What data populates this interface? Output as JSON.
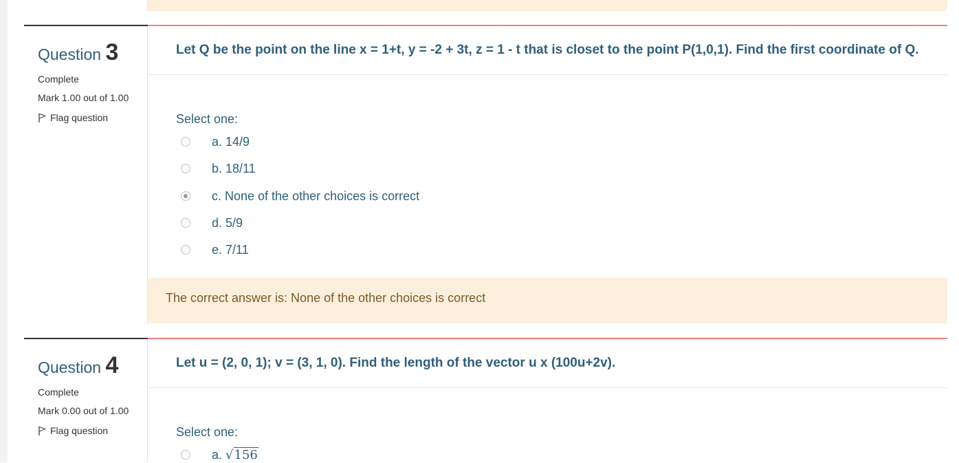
{
  "questions": [
    {
      "label": "Question",
      "number": "3",
      "state": "Complete",
      "grade": "Mark 1.00 out of 1.00",
      "flag_label": "Flag question",
      "text": "Let Q be the point on the line x = 1+t, y = -2 + 3t, z = 1 - t that is closet to the point P(1,0,1). Find the first coordinate of Q.",
      "prompt": "Select one:",
      "options": [
        {
          "label": "a. 14/9",
          "selected": false
        },
        {
          "label": "b. 18/11",
          "selected": false
        },
        {
          "label": "c. None of the other choices is correct",
          "selected": true
        },
        {
          "label": "d. 5/9",
          "selected": false
        },
        {
          "label": "e. 7/11",
          "selected": false
        }
      ],
      "feedback": "The correct answer is: None of the other choices is correct"
    },
    {
      "label": "Question",
      "number": "4",
      "state": "Complete",
      "grade": "Mark 0.00 out of 1.00",
      "flag_label": "Flag question",
      "text": "Let u = (2, 0, 1); v = (3, 1, 0). Find the length of the vector u x (100u+2v).",
      "prompt": "Select one:",
      "options": [
        {
          "prefix": "a.",
          "sqrt_value": "156",
          "selected": false
        }
      ]
    }
  ],
  "colors": {
    "question_text": "#2f5f7a",
    "accent_line": "#f08080",
    "feedback_bg": "#fcefdc",
    "feedback_text": "#7d5a29"
  },
  "icons": {
    "flag": "flag-icon"
  }
}
